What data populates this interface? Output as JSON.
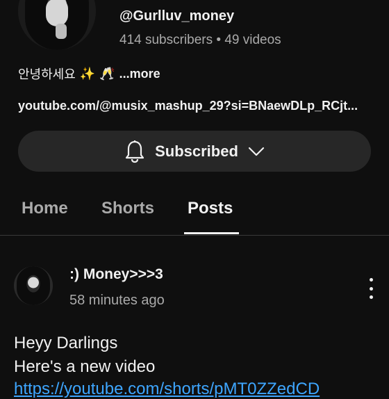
{
  "channel": {
    "handle": "@Gurlluv_money",
    "stats": "414 subscribers • 49 videos",
    "bio_text": "안녕하세요",
    "bio_emoji_1": "✨",
    "bio_emoji_2": "🥂",
    "bio_more": "...more",
    "link": "youtube.com/@musix_mashup_29?si=BNaewDLp_RCjt..."
  },
  "subscribe": {
    "label": "Subscribed",
    "bell_icon": "bell-icon",
    "chevron_icon": "chevron-down-icon"
  },
  "tabs": [
    {
      "label": "Home"
    },
    {
      "label": "Shorts"
    },
    {
      "label": "Posts"
    }
  ],
  "active_tab": "Posts",
  "post": {
    "author": ":) Money>>>3",
    "time": "58 minutes ago",
    "line1": "Heyy Darlings",
    "line2": "Here's a new video",
    "link_text": "https://youtube.com/shorts/pMT0ZZedCD"
  },
  "colors": {
    "background": "#0f0f0f",
    "text": "#f1f1f1",
    "secondary_text": "#aaaaaa",
    "button_bg": "#272727",
    "link": "#3ea6ff"
  }
}
